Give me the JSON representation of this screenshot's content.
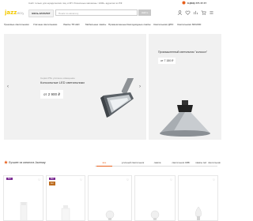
{
  "topbar": {
    "message": "Сайт только для юридических лиц и ИП. Розничные магазины: 1000+ адресов по РФ",
    "phone": "8 (800) 777-77-77"
  },
  "header": {
    "logo_text": "jazzway",
    "catalog_label": "ВЕСЬ КАТАЛОГ",
    "search_placeholder": "Поиск по каталогу",
    "search_button": "Найти"
  },
  "nav": [
    "Трековые светильники",
    "Уличные светильники",
    "Лампы T8 LED",
    "Мебельные лампы",
    "Промышленные",
    "Светодиодные лампы",
    "Светильники ДПО",
    "Светильники 600x600"
  ],
  "hero_main": {
    "caption": "Серия PSL уличное освещение",
    "title": "Консольные LED светильники",
    "price": "от 2 900 ₽",
    "prev_icon": "‹",
    "next_icon": "›"
  },
  "hero_side": {
    "title": "Промышленный светильник \"колокол\"",
    "price": "от 7 150 ₽"
  },
  "section": {
    "title": "Лучшее из каталога Jazzway",
    "filters": [
      "все",
      "уличный светильник",
      "лампа",
      "светильник 40Вт",
      "лампы led",
      "светильник"
    ],
    "active_filter": 0
  },
  "cards": [
    {
      "badge": "Хит",
      "badge2": "",
      "product_icon": "tube-lamp-icon"
    },
    {
      "badge": "Хит",
      "badge2": "Хит",
      "product_icon": "cylinder-lamp-icon"
    },
    {
      "badge": "",
      "badge2": "",
      "product_icon": "bulb-icon"
    },
    {
      "badge": "",
      "badge2": "",
      "product_icon": "bulb-icon"
    },
    {
      "badge": "",
      "badge2": "",
      "product_icon": "candle-bulb-icon"
    }
  ],
  "colors": {
    "accent": "#e8601c",
    "badge_purple": "#7a2a92",
    "badge_orange": "#bd6c1e",
    "logo_yellow": "#f3c900"
  }
}
